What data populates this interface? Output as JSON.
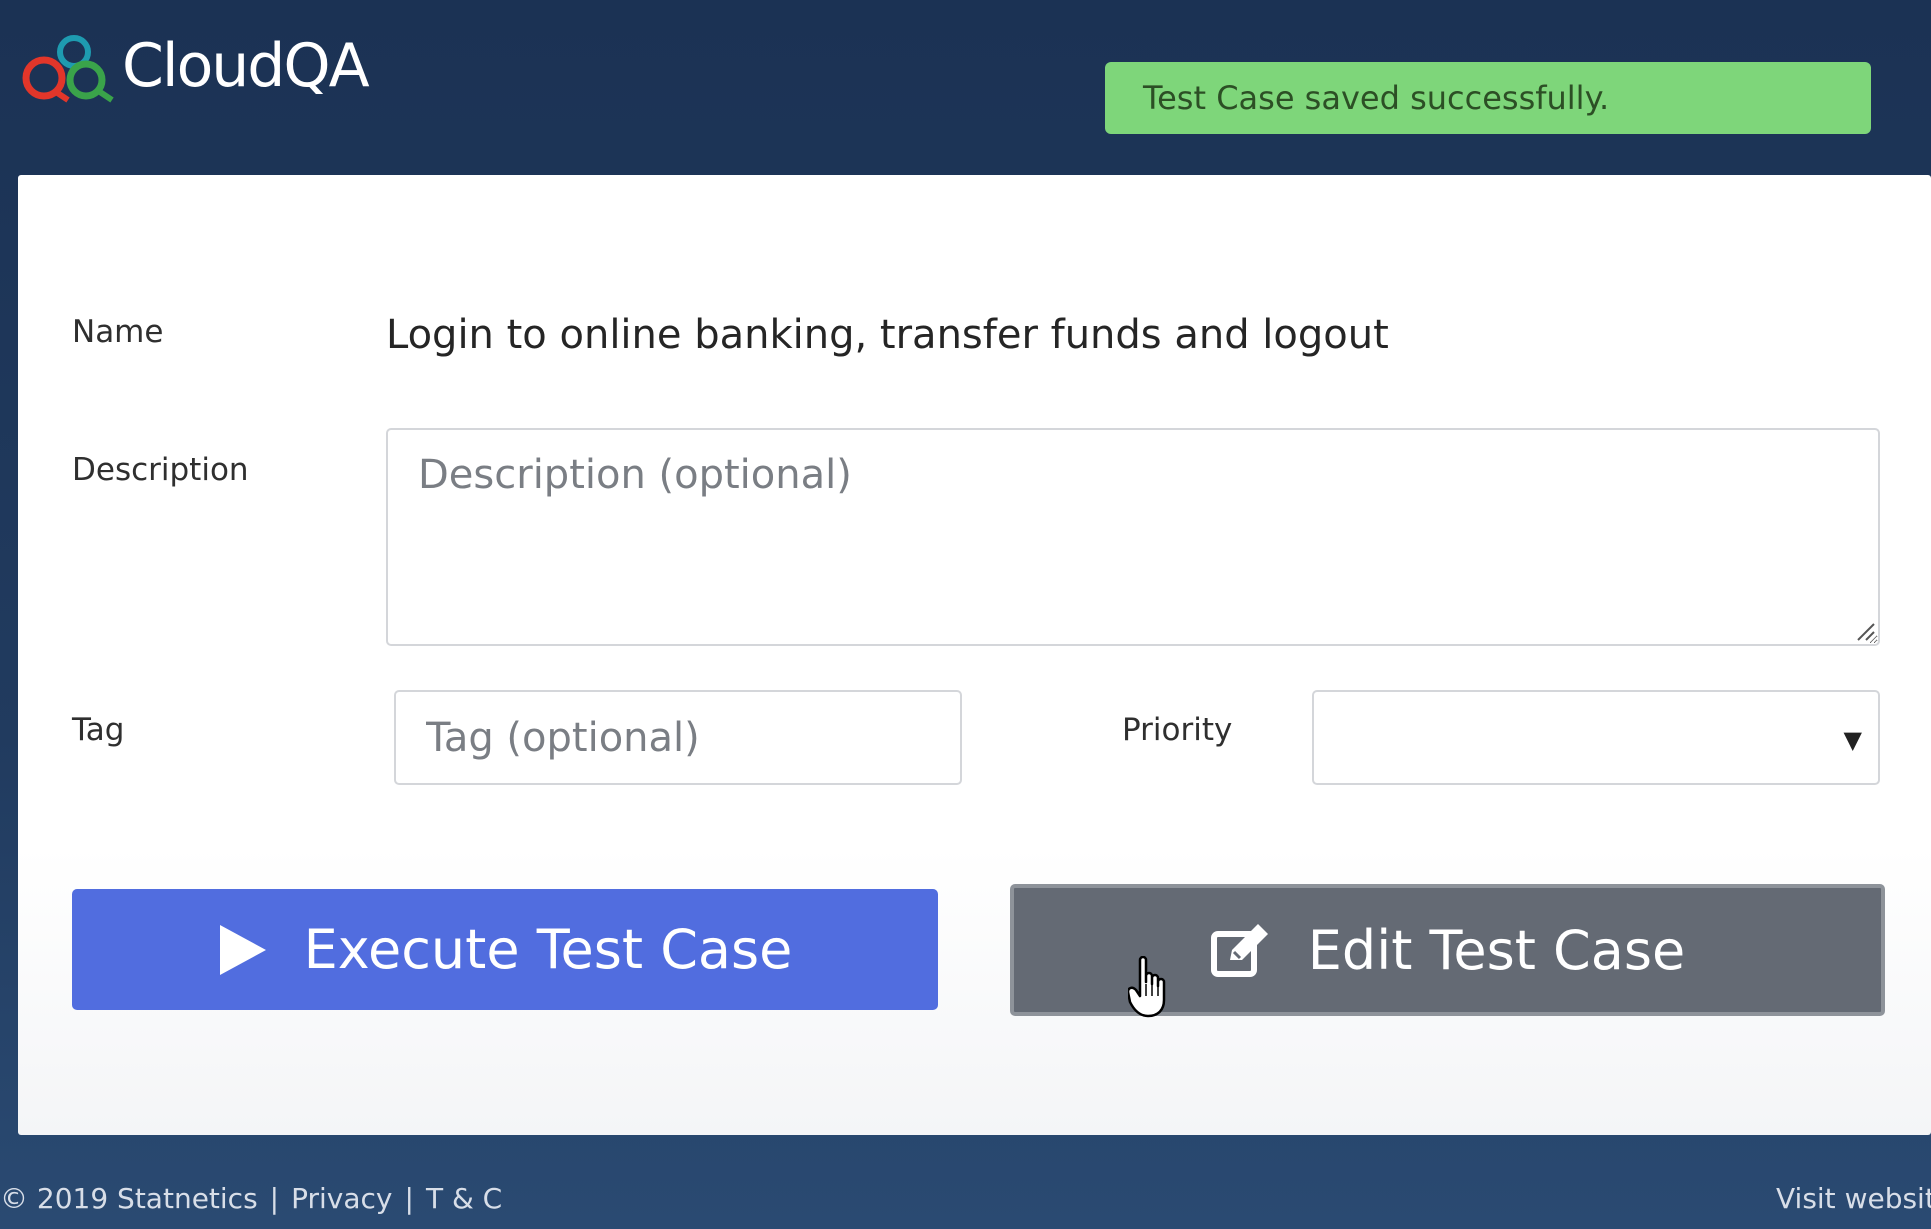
{
  "header": {
    "logo_text": "CloudQA",
    "toast_message": "Test Case saved successfully."
  },
  "form": {
    "name_label": "Name",
    "name_value": "Login to online banking, transfer funds and logout",
    "description_label": "Description",
    "description_placeholder": "Description (optional)",
    "tag_label": "Tag",
    "tag_placeholder": "Tag (optional)",
    "priority_label": "Priority",
    "priority_value": ""
  },
  "actions": {
    "execute_label": "Execute Test Case",
    "edit_label": "Edit Test Case"
  },
  "footer": {
    "copyright": "© 2019 Statnetics",
    "privacy": "Privacy",
    "terms": "T & C",
    "separator": "|",
    "visit_website": "Visit website"
  },
  "colors": {
    "header_bg": "#1b3254",
    "toast_bg": "#7ed67a",
    "execute_bg": "#516ddf",
    "edit_bg": "#646a74"
  }
}
